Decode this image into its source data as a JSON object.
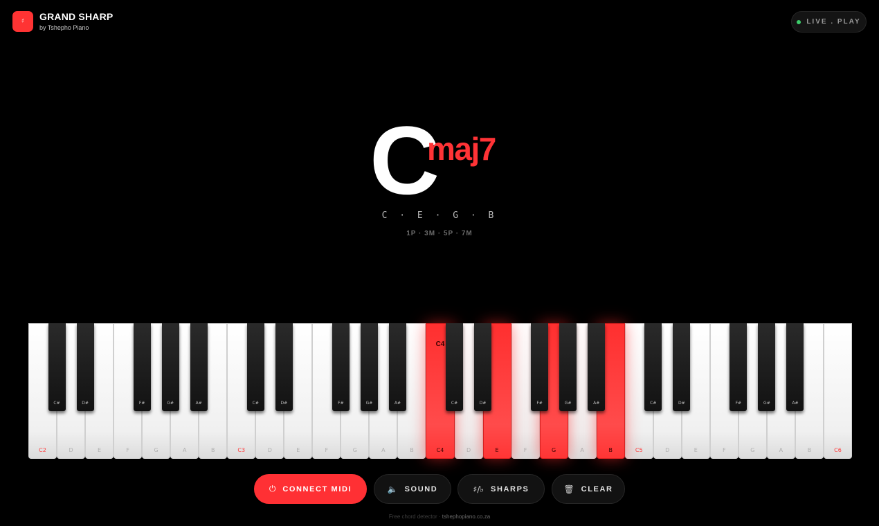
{
  "header": {
    "logo_glyph": "♯",
    "title": "GRAND SHARP",
    "subtitle": "by Tshepho Piano",
    "live_label": "LIVE . PLAY",
    "live_color": "#3ccd6a"
  },
  "chord": {
    "root": "C",
    "quality": "maj7",
    "notes": "C · E · G · B",
    "intervals": "1P · 3M · 5P · 7M",
    "accent_color": "#ff3336"
  },
  "keyboard": {
    "white_keys": [
      "C2",
      "D",
      "E",
      "F",
      "G",
      "A",
      "B",
      "C3",
      "D",
      "E",
      "F",
      "G",
      "A",
      "B",
      "C4",
      "D",
      "E",
      "F",
      "G",
      "A",
      "B",
      "C5",
      "D",
      "E",
      "F",
      "G",
      "A",
      "B",
      "C6"
    ],
    "black_keys": [
      "C#",
      "D#",
      "F#",
      "G#",
      "A#",
      "C#",
      "D#",
      "F#",
      "G#",
      "A#",
      "C#",
      "D#",
      "F#",
      "G#",
      "A#",
      "C#",
      "D#",
      "F#",
      "G#",
      "A#"
    ],
    "active_white": [
      14,
      16,
      18,
      20
    ],
    "active_black": [],
    "octave_c_label_positions": [
      0,
      7,
      21,
      28
    ],
    "highlighted_key_label": "C4"
  },
  "controls": {
    "connect_midi": "CONNECT MIDI",
    "connect_midi_icon": "⏻",
    "sound": "SOUND",
    "sound_icon": "🔈",
    "sharps": "SHARPS",
    "sharps_icon": "♯/♭",
    "clear": "CLEAR",
    "clear_icon": "🗑"
  },
  "footer": {
    "text": "Free chord detector ·",
    "link": "tshephopiano.co.za"
  }
}
